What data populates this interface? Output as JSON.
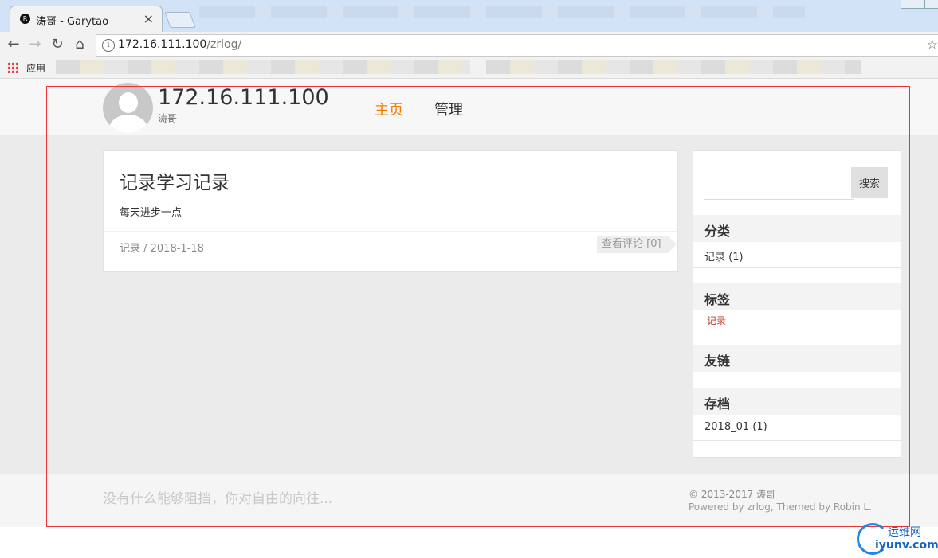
{
  "browser": {
    "tab_title": "涛哥 - Garytao",
    "tab_favicon": "R",
    "close_glyph": "×",
    "back_glyph": "←",
    "forward_glyph": "→",
    "reload_glyph": "↻",
    "home_glyph": "⌂",
    "info_glyph": "i",
    "star_glyph": "☆",
    "url_host": "172.16.111.100",
    "url_path": "/zrlog/",
    "bookmarks_apps_label": "应用"
  },
  "site": {
    "title": "172.16.111.100",
    "subtitle": "涛哥",
    "nav": [
      "主页",
      "管理"
    ],
    "nav_active_color": "#f57c00"
  },
  "post": {
    "title": "记录学习记录",
    "excerpt": "每天进步一点",
    "meta": "记录 / 2018-1-18",
    "comments_label": "查看评论 [0]"
  },
  "sidebar": {
    "search_button": "搜索",
    "search_value": "",
    "categories": {
      "title": "分类",
      "items": [
        "记录 (1)"
      ]
    },
    "tags": {
      "title": "标签",
      "items": [
        "记录"
      ]
    },
    "links": {
      "title": "友链"
    },
    "archives": {
      "title": "存档",
      "items": [
        "2018_01 (1)"
      ]
    }
  },
  "footer": {
    "motto": "没有什么能够阻挡，你对自由的向往...",
    "copyright": "© 2013-2017 涛哥",
    "powered": "Powered by zrlog, Themed by Robin L."
  },
  "watermark": {
    "cn": "运维网",
    "en": "iyunv.com"
  }
}
